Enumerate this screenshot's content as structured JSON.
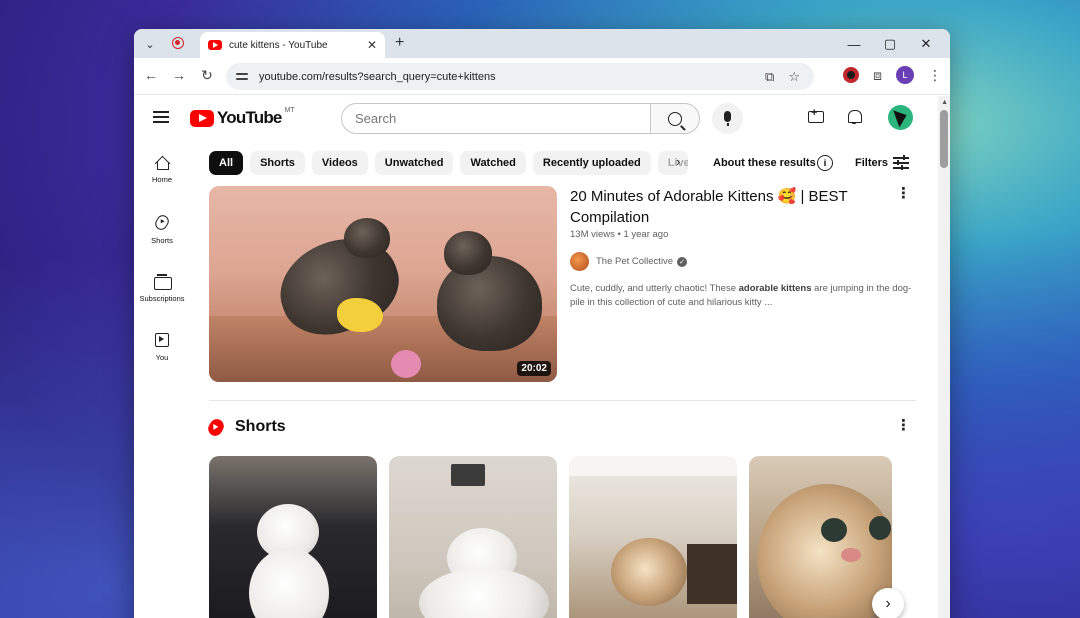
{
  "browser": {
    "tab_title": "cute kittens - YouTube",
    "tab_close": "✕",
    "new_tab": "+",
    "url": "youtube.com/results?search_query=cute+kittens",
    "window_minimize": "—",
    "window_maximize": "▢",
    "window_close": "✕",
    "profile_letter": "L",
    "icons": [
      "tab-search-icon",
      "record-icon",
      "back-icon",
      "forward-icon",
      "reload-icon",
      "site-info-icon",
      "install-icon",
      "star-icon",
      "extension-icon",
      "puzzle-icon",
      "menu-icon"
    ]
  },
  "youtube": {
    "logo_text": "YouTube",
    "country_code": "MT",
    "search_placeholder": "Search",
    "sidebar": [
      {
        "label": "Home",
        "icon": "home-icon"
      },
      {
        "label": "Shorts",
        "icon": "shorts-icon"
      },
      {
        "label": "Subscriptions",
        "icon": "subscriptions-icon"
      },
      {
        "label": "You",
        "icon": "you-icon"
      }
    ],
    "chips": [
      "All",
      "Shorts",
      "Videos",
      "Unwatched",
      "Watched",
      "Recently uploaded",
      "Live"
    ],
    "active_chip": "All",
    "about_results": "About these results",
    "filters_label": "Filters",
    "video": {
      "title": "20 Minutes of Adorable Kittens 🥰 | BEST Compilation",
      "meta": "13M views • 1 year ago",
      "channel": "The Pet Collective",
      "duration": "20:02",
      "description_pre": "Cute, cuddly, and utterly chaotic! These ",
      "description_bold": "adorable kittens",
      "description_post": " are jumping in the dog-pile in this collection of cute and hilarious kitty ..."
    },
    "shorts_title": "Shorts",
    "colors": {
      "brand_red": "#ff0000",
      "chip_active_bg": "#0f0f0f",
      "chip_bg": "#f2f2f2",
      "avatar_green": "#2bb57d"
    }
  }
}
